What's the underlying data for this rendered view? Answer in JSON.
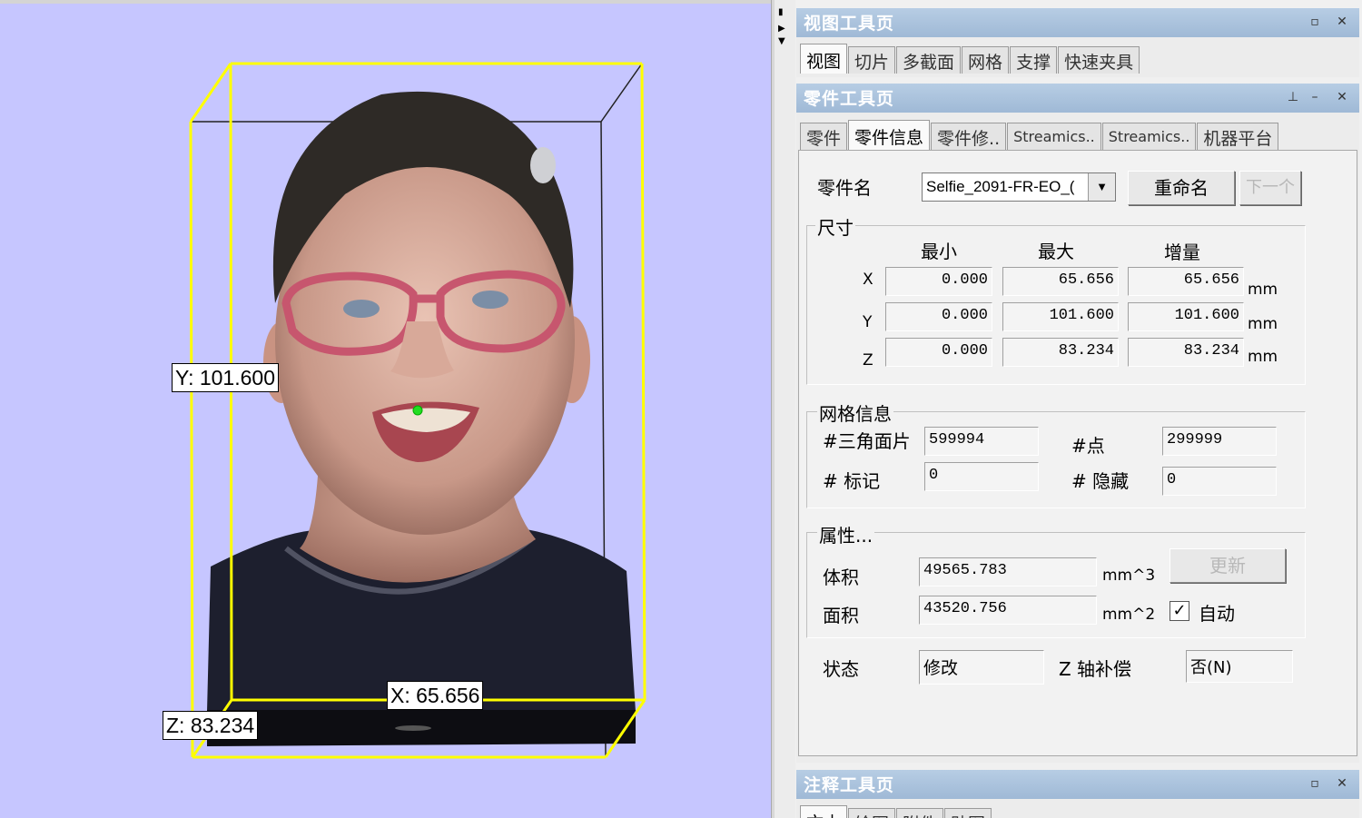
{
  "viewport": {
    "dim_y": "Y: 101.600",
    "dim_x": "X: 65.656",
    "dim_z": "Z: 83.234"
  },
  "view_page": {
    "title": "视图工具页",
    "tabs": [
      "视图",
      "切片",
      "多截面",
      "网格",
      "支撑",
      "快速夹具"
    ]
  },
  "part_page": {
    "title": "零件工具页",
    "tabs": [
      "零件",
      "零件信息",
      "零件修..",
      "Streamics..",
      "Streamics..",
      "机器平台"
    ],
    "part_name_label": "零件名",
    "part_name_value": "Selfie_2091-FR-EO_(",
    "rename_button": "重命名",
    "next_button": "下一个",
    "size_group": "尺寸",
    "col_min": "最小",
    "col_max": "最大",
    "col_delta": "增量",
    "unit": "mm",
    "rows": [
      {
        "axis": "X",
        "min": "0.000",
        "max": "65.656",
        "delta": "65.656"
      },
      {
        "axis": "Y",
        "min": "0.000",
        "max": "101.600",
        "delta": "101.600"
      },
      {
        "axis": "Z",
        "min": "0.000",
        "max": "83.234",
        "delta": "83.234"
      }
    ],
    "mesh_group": "网格信息",
    "triangles_label": "#三角面片",
    "triangles_value": "599994",
    "points_label": "#点",
    "points_value": "299999",
    "marked_label": "# 标记",
    "marked_value": "0",
    "hidden_label": "# 隐藏",
    "hidden_value": "0",
    "props_group": "属性...",
    "volume_label": "体积",
    "volume_value": "49565.783",
    "volume_unit": "mm^3",
    "area_label": "面积",
    "area_value": "43520.756",
    "area_unit": "mm^2",
    "update_button": "更新",
    "auto_label": "自动",
    "auto_checked": "✓",
    "status_label": "状态",
    "status_value": "修改",
    "zcomp_label": "Z 轴补偿",
    "zcomp_value": "否(N)"
  },
  "annotation_page": {
    "title": "注释工具页",
    "tabs": [
      "文本",
      "绘图",
      "附件",
      "贴图"
    ]
  },
  "colors": {
    "viewport_bg": "#c6c6ff",
    "bbox_yellow": "#ffff00",
    "title_bar": "#a8c2de"
  }
}
